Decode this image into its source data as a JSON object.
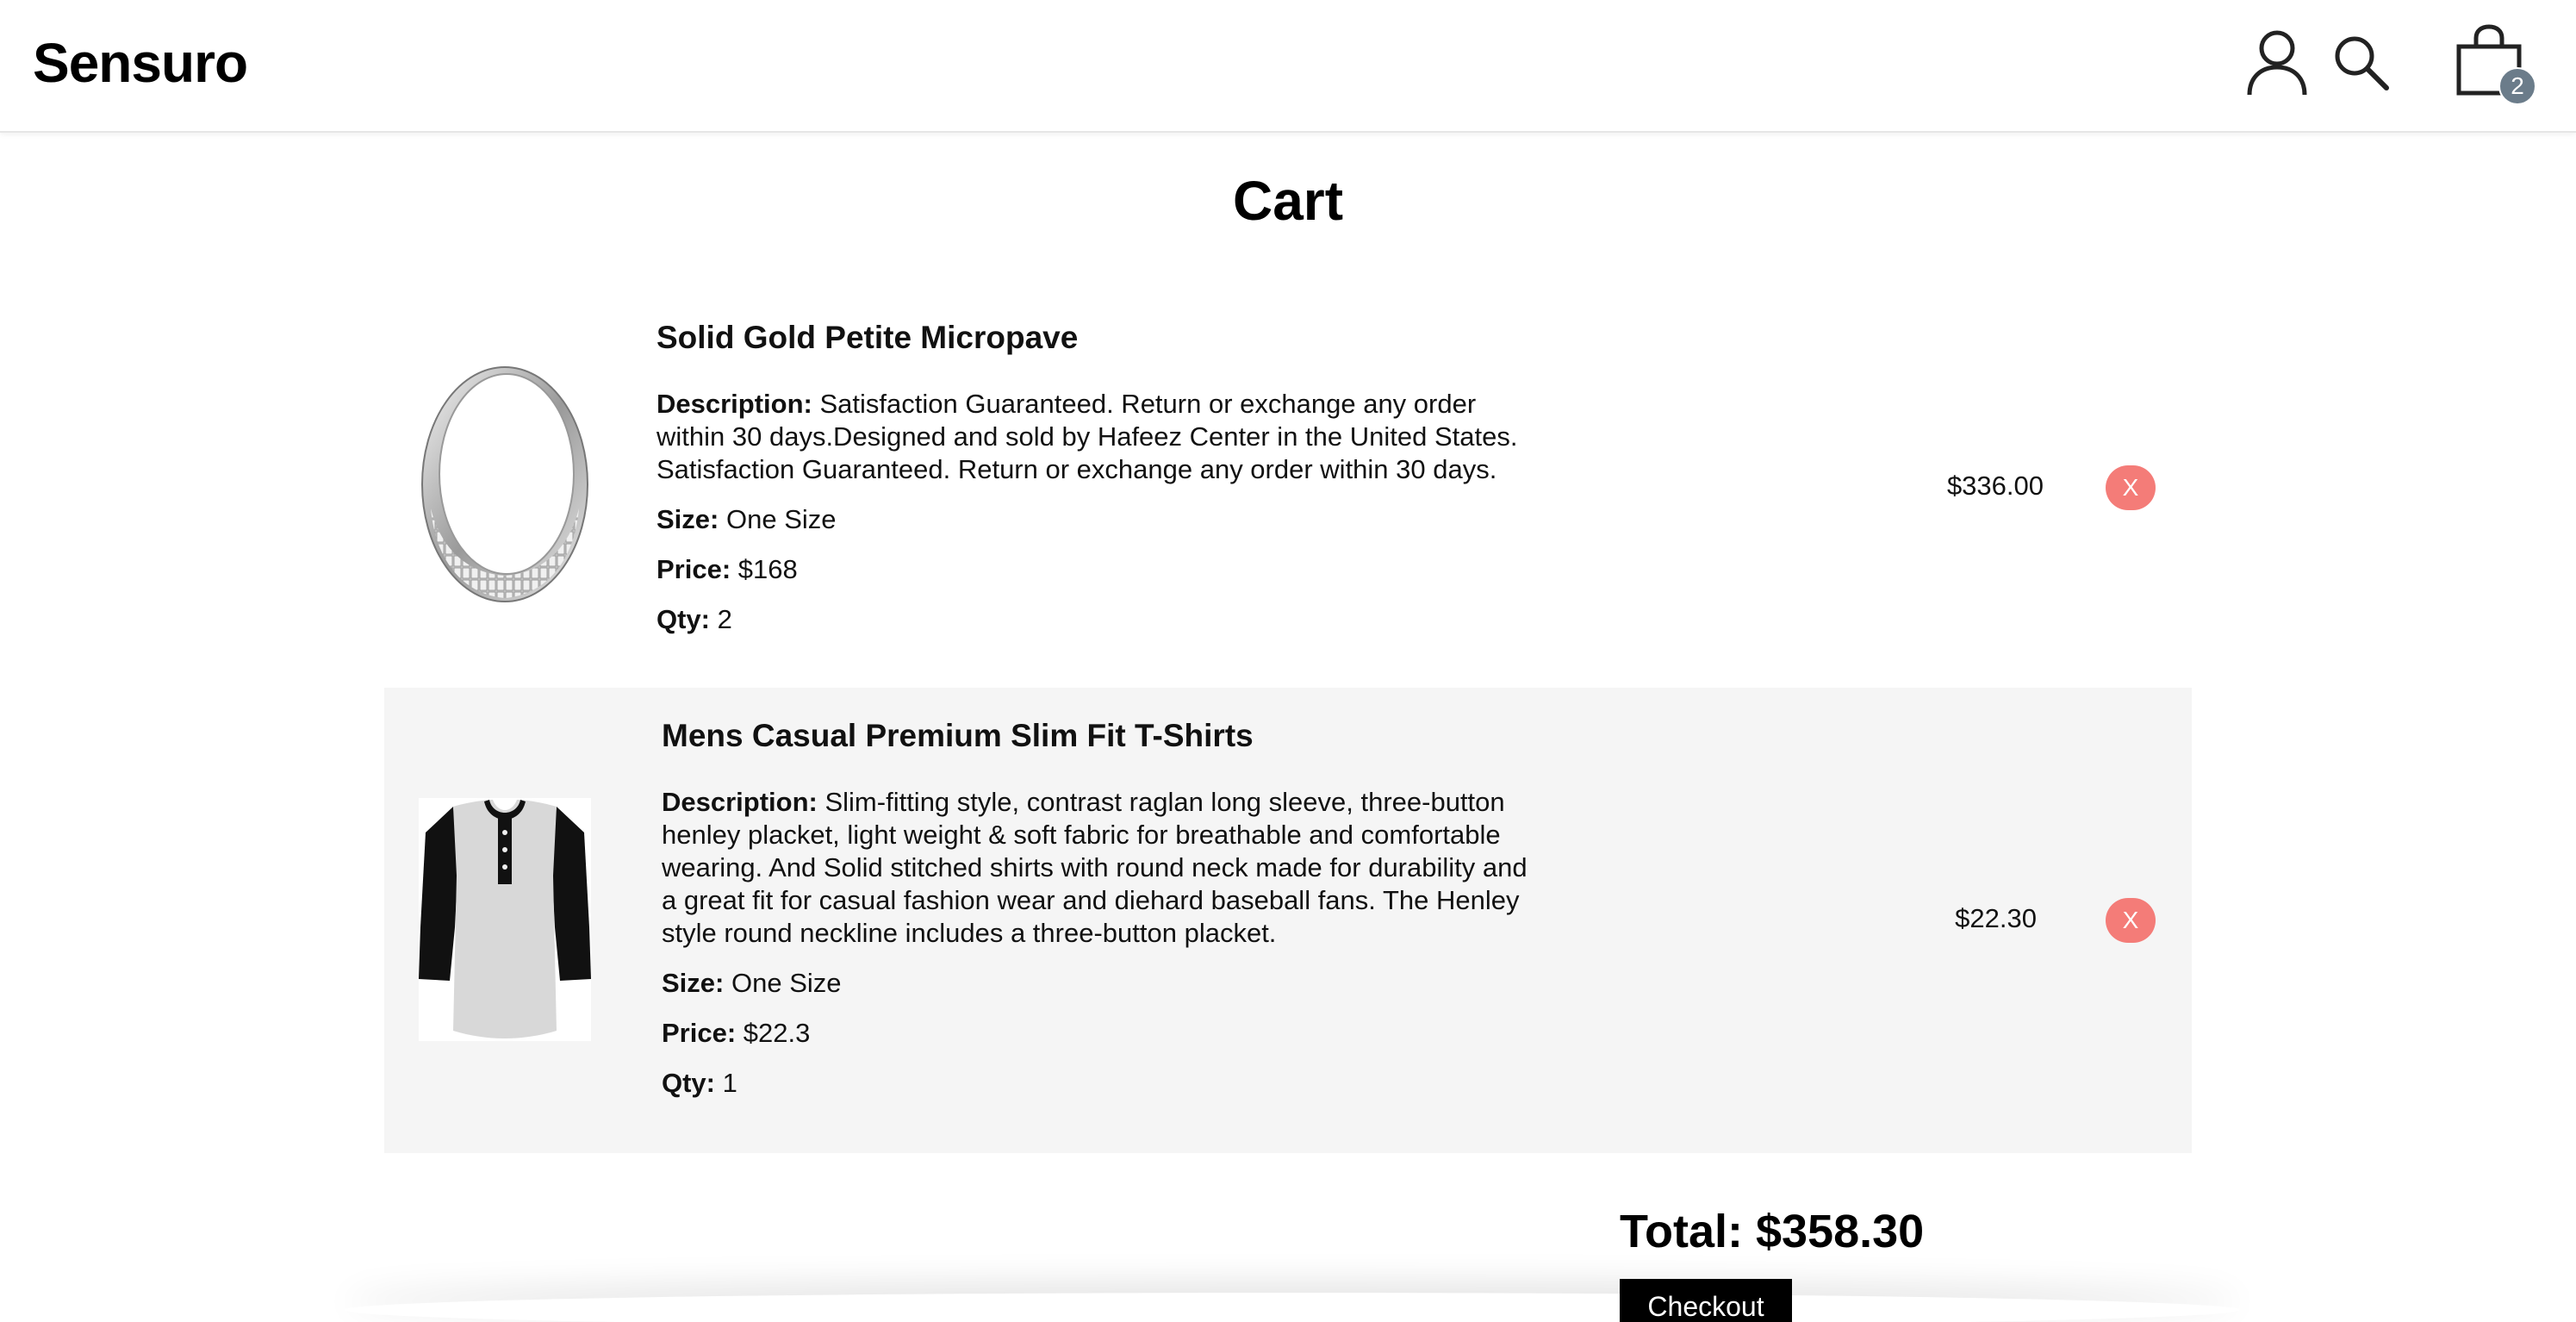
{
  "header": {
    "logo": "Sensuro",
    "icons": [
      "user-icon",
      "search-icon",
      "shopping-bag-icon"
    ],
    "cart_count": "2"
  },
  "page": {
    "title": "Cart"
  },
  "labels": {
    "description": "Description:",
    "size": "Size:",
    "price": "Price:",
    "qty": "Qty:",
    "remove": "X"
  },
  "cart": {
    "items": [
      {
        "name": "Solid Gold Petite Micropave",
        "description": "Satisfaction Guaranteed. Return or exchange any order within 30 days.Designed and sold by Hafeez Center in the United States. Satisfaction Guaranteed. Return or exchange any order within 30 days.",
        "size": "One Size",
        "price": "$168",
        "qty": "2",
        "subtotal": "$336.00"
      },
      {
        "name": "Mens Casual Premium Slim Fit T-Shirts",
        "description": "Slim-fitting style, contrast raglan long sleeve, three-button henley placket, light weight & soft fabric for breathable and comfortable wearing. And Solid stitched shirts with round neck made for durability and a great fit for casual fashion wear and diehard baseball fans. The Henley style round neckline includes a three-button placket.",
        "size": "One Size",
        "price": "$22.3",
        "qty": "1",
        "subtotal": "$22.30"
      }
    ],
    "total": "Total: $358.30",
    "checkout_label": "Checkout"
  },
  "colors": {
    "remove_button": "#f47c78",
    "badge": "#6b7c8a",
    "alt_row": "#f5f5f5",
    "checkout": "#000000"
  }
}
